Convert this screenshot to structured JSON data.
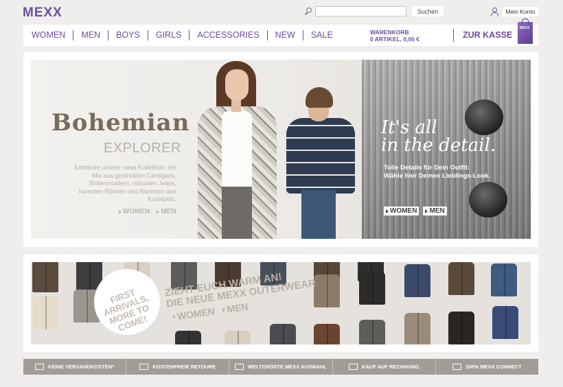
{
  "header": {
    "logo": "MEXX",
    "search": {
      "placeholder": "",
      "button_label": "Suchen"
    },
    "account_label": "Mein Konto"
  },
  "nav": {
    "items": [
      "WOMEN",
      "MEN",
      "BOYS",
      "GIRLS",
      "ACCESSORIES",
      "NEW",
      "SALE"
    ],
    "cart_title": "WARENKORB",
    "cart_summary": "0 ARTIKEL, 0,00 €",
    "checkout_label": "ZUR KASSE",
    "bag_label": "MEXX"
  },
  "hero": {
    "left": {
      "title": "Bohemian",
      "subtitle": "EXPLORER",
      "text": "Entdecke unsere neue Kollektion: ein Mix aus gestrickten Cardigans, Blütenmustern, robusten Jeans, karierten Röcken und Akzenten aus Kunstpelz.",
      "link_women": "WOMEN",
      "link_men": "MEN"
    },
    "right": {
      "title_line1": "It's all",
      "title_line2": "in the detail.",
      "text_line1": "Tolle Details für Dein Outfit:",
      "text_line2": "Wähle hier Deinen Lieblings-Look.",
      "link_women": "WOMEN",
      "link_men": "MEN"
    }
  },
  "outerwear": {
    "badge_line1": "FIRST",
    "badge_line2": "ARRIVALS,",
    "badge_line3": "MORE TO",
    "badge_line4": "COME!",
    "title_line1": "ZIEHT EUCH WARM AN!",
    "title_line2": "DIE NEUE MEXX OUTERWEAR",
    "link_women": "WOMEN",
    "link_men": "MEN"
  },
  "benefits": [
    "KEINE VERSANDKOSTEN*",
    "KOSTENFREIE RETOURE",
    "WELTGRÖßTE MEXX AUSWAHL",
    "KAUF AUF RECHNUNG",
    "100% MEXX CONNECT"
  ],
  "colors": {
    "brand": "#6b4ea0",
    "background": "#efeeec",
    "benefit_bar": "#a29c96"
  }
}
